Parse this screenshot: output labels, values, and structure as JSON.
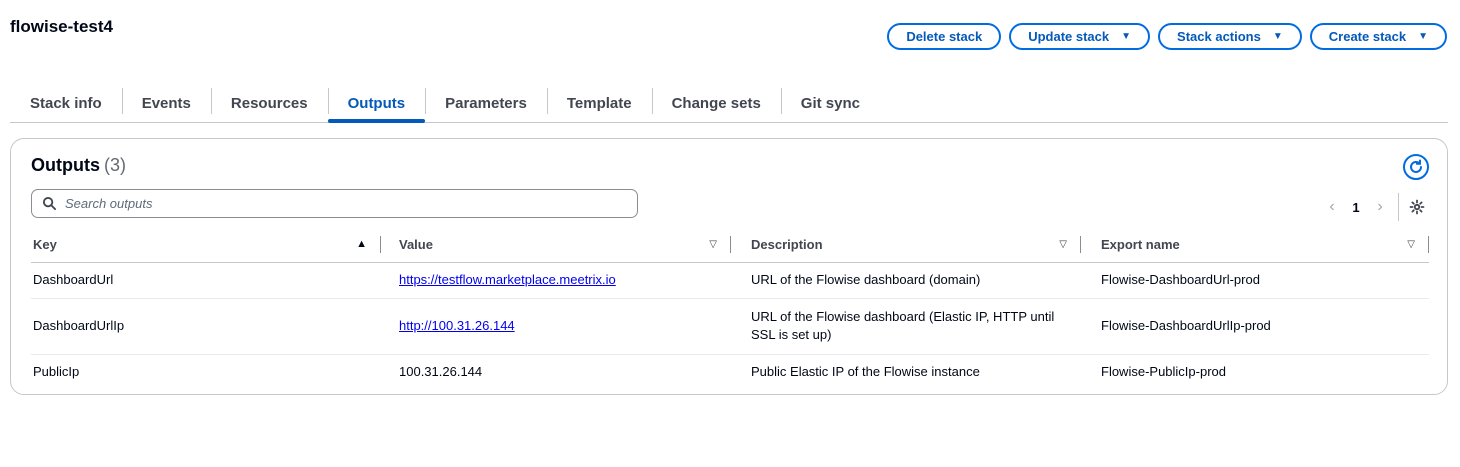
{
  "page": {
    "title": "flowise-test4"
  },
  "actions": {
    "delete": "Delete stack",
    "update": "Update stack",
    "stack_actions": "Stack actions",
    "create": "Create stack"
  },
  "tabs": [
    {
      "label": "Stack info",
      "active": false
    },
    {
      "label": "Events",
      "active": false
    },
    {
      "label": "Resources",
      "active": false
    },
    {
      "label": "Outputs",
      "active": true
    },
    {
      "label": "Parameters",
      "active": false
    },
    {
      "label": "Template",
      "active": false
    },
    {
      "label": "Change sets",
      "active": false
    },
    {
      "label": "Git sync",
      "active": false
    }
  ],
  "outputs": {
    "title": "Outputs",
    "count": "(3)",
    "search_placeholder": "Search outputs",
    "page_number": "1",
    "columns": {
      "key": "Key",
      "value": "Value",
      "description": "Description",
      "export": "Export name"
    },
    "rows": [
      {
        "key": "DashboardUrl",
        "value": "https://testflow.marketplace.meetrix.io",
        "value_is_link": true,
        "description": "URL of the Flowise dashboard (domain)",
        "export": "Flowise-DashboardUrl-prod"
      },
      {
        "key": "DashboardUrlIp",
        "value": "http://100.31.26.144",
        "value_is_link": true,
        "description": "URL of the Flowise dashboard (Elastic IP, HTTP until SSL is set up)",
        "export": "Flowise-DashboardUrlIp-prod"
      },
      {
        "key": "PublicIp",
        "value": "100.31.26.144",
        "value_is_link": false,
        "description": "Public Elastic IP of the Flowise instance",
        "export": "Flowise-PublicIp-prod"
      }
    ]
  },
  "colors": {
    "accent": "#0559b8",
    "border": "#c6c6cd",
    "link": "#0000ee"
  }
}
